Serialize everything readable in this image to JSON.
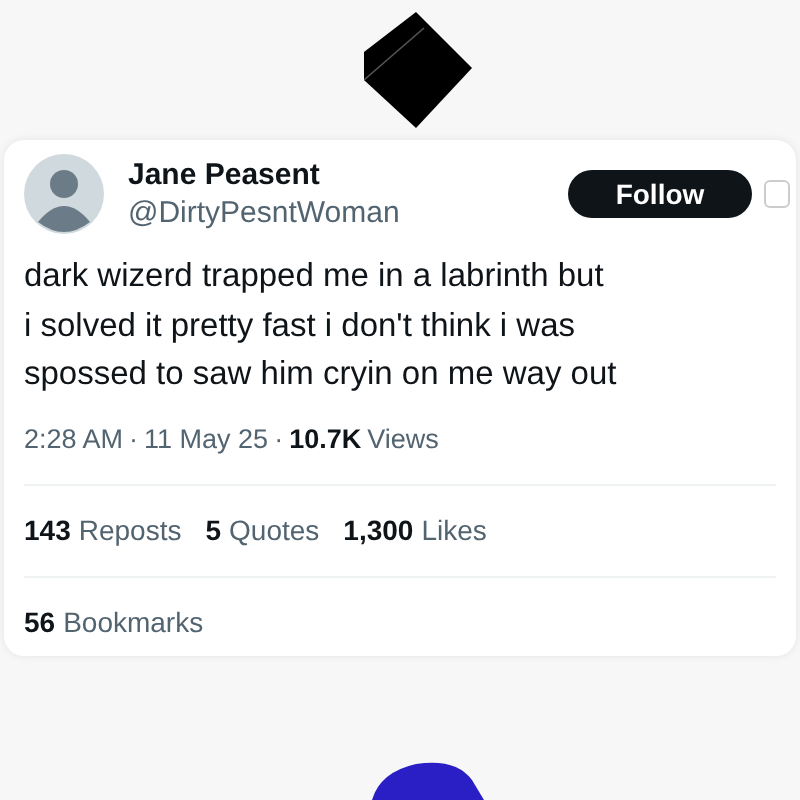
{
  "post": {
    "author": {
      "name": "Jane Peasent",
      "handle": "@DirtyPesntWoman"
    },
    "follow_button": "Follow",
    "text_lines": [
      "dark wizerd trapped me in a labrinth but",
      "i solved it pretty fast i don't think i was",
      "spossed to saw him cryin on me way out"
    ],
    "meta": {
      "time": "2:28 AM",
      "separator": "·",
      "date": "11 May 25",
      "views_count": "10.7K",
      "views_label": "Views"
    },
    "stats": [
      {
        "count": "143",
        "label": "Reposts"
      },
      {
        "count": "5",
        "label": "Quotes"
      },
      {
        "count": "1,300",
        "label": "Likes"
      }
    ],
    "bookmarks": {
      "count": "56",
      "label": "Bookmarks"
    }
  }
}
